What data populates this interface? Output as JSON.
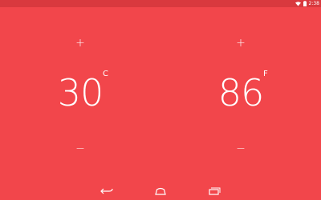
{
  "status_bar": {
    "time": "2:38",
    "icons": [
      "wifi-icon",
      "battery-icon"
    ]
  },
  "celsius": {
    "increment_label": "+",
    "value": "30",
    "unit": "C",
    "decrement_label": "−"
  },
  "fahrenheit": {
    "increment_label": "+",
    "value": "86",
    "unit": "F",
    "decrement_label": "−"
  },
  "nav_bar": {
    "icons": [
      "back-icon",
      "home-icon",
      "recents-icon"
    ]
  },
  "colors": {
    "background": "#f2464b",
    "status_bar": "#d9393e",
    "foreground": "#ffffff"
  }
}
